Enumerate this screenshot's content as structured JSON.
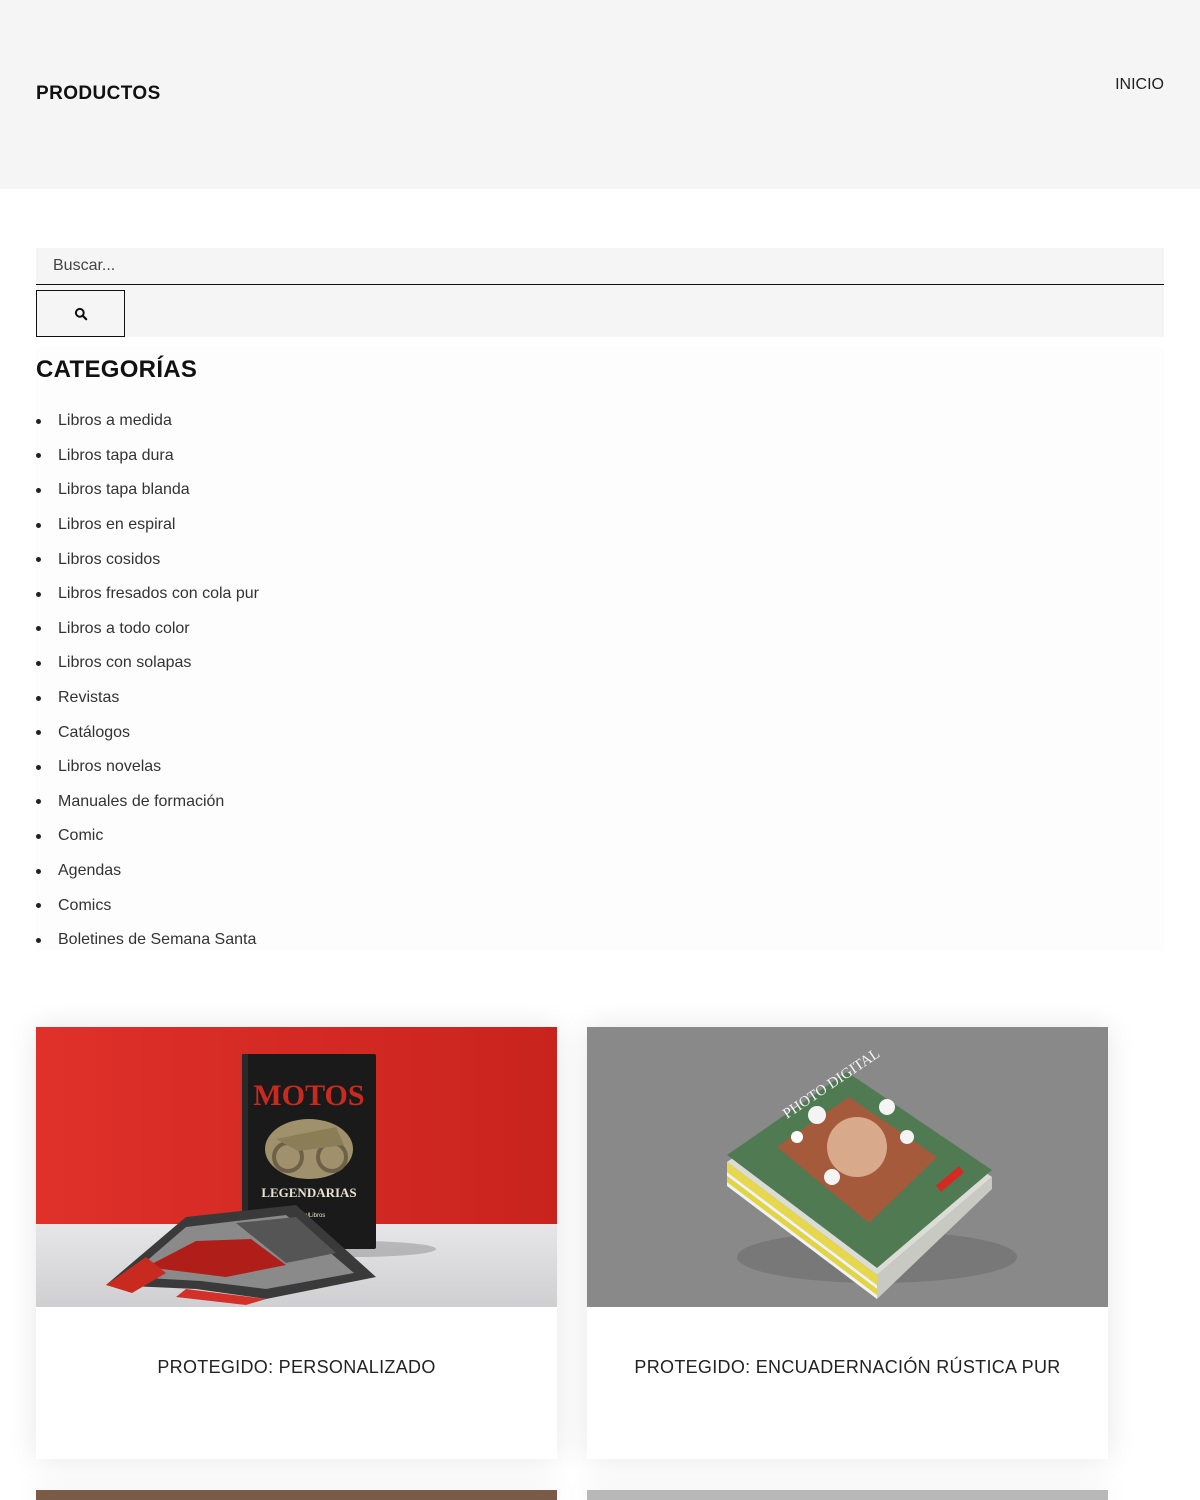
{
  "header": {
    "title": "PRODUCTOS",
    "nav_inicio": "INICIO"
  },
  "search": {
    "placeholder": "Buscar...",
    "button_icon": "search-icon"
  },
  "categories": {
    "title": "CATEGORÍAS",
    "items": [
      "Libros a medida",
      "Libros tapa dura",
      "Libros tapa blanda",
      "Libros en espiral",
      "Libros cosidos",
      "Libros fresados con cola pur",
      "Libros a todo color",
      "Libros con solapas",
      "Revistas",
      "Catálogos",
      "Libros novelas",
      "Manuales de formación",
      "Comic",
      "Agendas",
      "Comics",
      "Boletines de Semana Santa"
    ]
  },
  "products": [
    {
      "title": "PROTEGIDO: PERSONALIZADO",
      "image_cover_title": "MOTOS",
      "image_cover_subtitle": "LEGENDARIAS",
      "image_cover_brand": "VisualLibros"
    },
    {
      "title": "PROTEGIDO: ENCUADERNACIÓN RÚSTICA PUR",
      "image_cover_title": "PHOTO DIGITAL"
    }
  ],
  "colors": {
    "header_bg": "#f5f5f5",
    "text_dark": "#111111",
    "accent_red": "#d42a23"
  }
}
